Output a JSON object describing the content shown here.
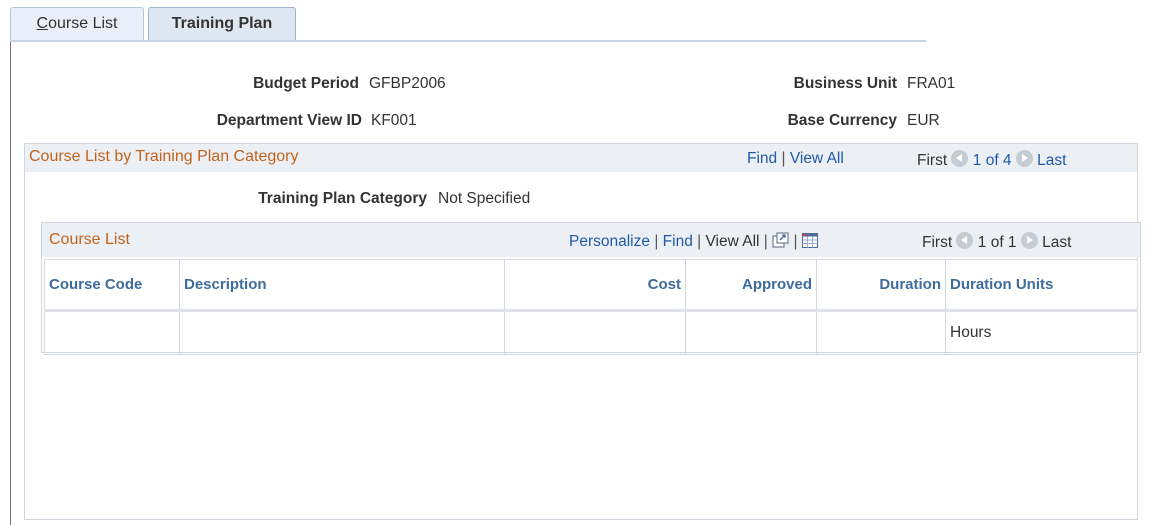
{
  "tabs": [
    {
      "accesskey": "C",
      "rest": "ourse List",
      "active": false
    },
    {
      "label": "Training Plan",
      "active": true
    }
  ],
  "header": {
    "budget_period_label": "Budget Period",
    "budget_period_value": "GFBP2006",
    "business_unit_label": "Business Unit",
    "business_unit_value": "FRA01",
    "dept_view_label": "Department View ID",
    "dept_view_value": "KF001",
    "base_currency_label": "Base Currency",
    "base_currency_value": "EUR"
  },
  "outer_group": {
    "title": "Course List by Training Plan Category",
    "find": "Find",
    "sep": "|",
    "view_all": "View All",
    "first": "First",
    "range": "1 of 4",
    "last": "Last",
    "category_label": "Training Plan Category",
    "category_value": "Not Specified"
  },
  "inner_grid": {
    "title": "Course List",
    "personalize": "Personalize",
    "find": "Find",
    "view_all": "View All",
    "sep": "|",
    "first": "First",
    "range": "1 of 1",
    "last": "Last",
    "columns": [
      "Course Code",
      "Description",
      "Cost",
      "Approved",
      "Duration",
      "Duration Units"
    ],
    "rows": [
      [
        "",
        "",
        "",
        "",
        "",
        "Hours"
      ]
    ]
  },
  "colors": {
    "title_orange": "#c2621b",
    "link_blue": "#1f5aa8",
    "column_header": "#3f6c9c"
  },
  "icons": [
    "prev-arrow-icon",
    "next-arrow-icon",
    "new-window-icon",
    "download-grid-icon"
  ]
}
